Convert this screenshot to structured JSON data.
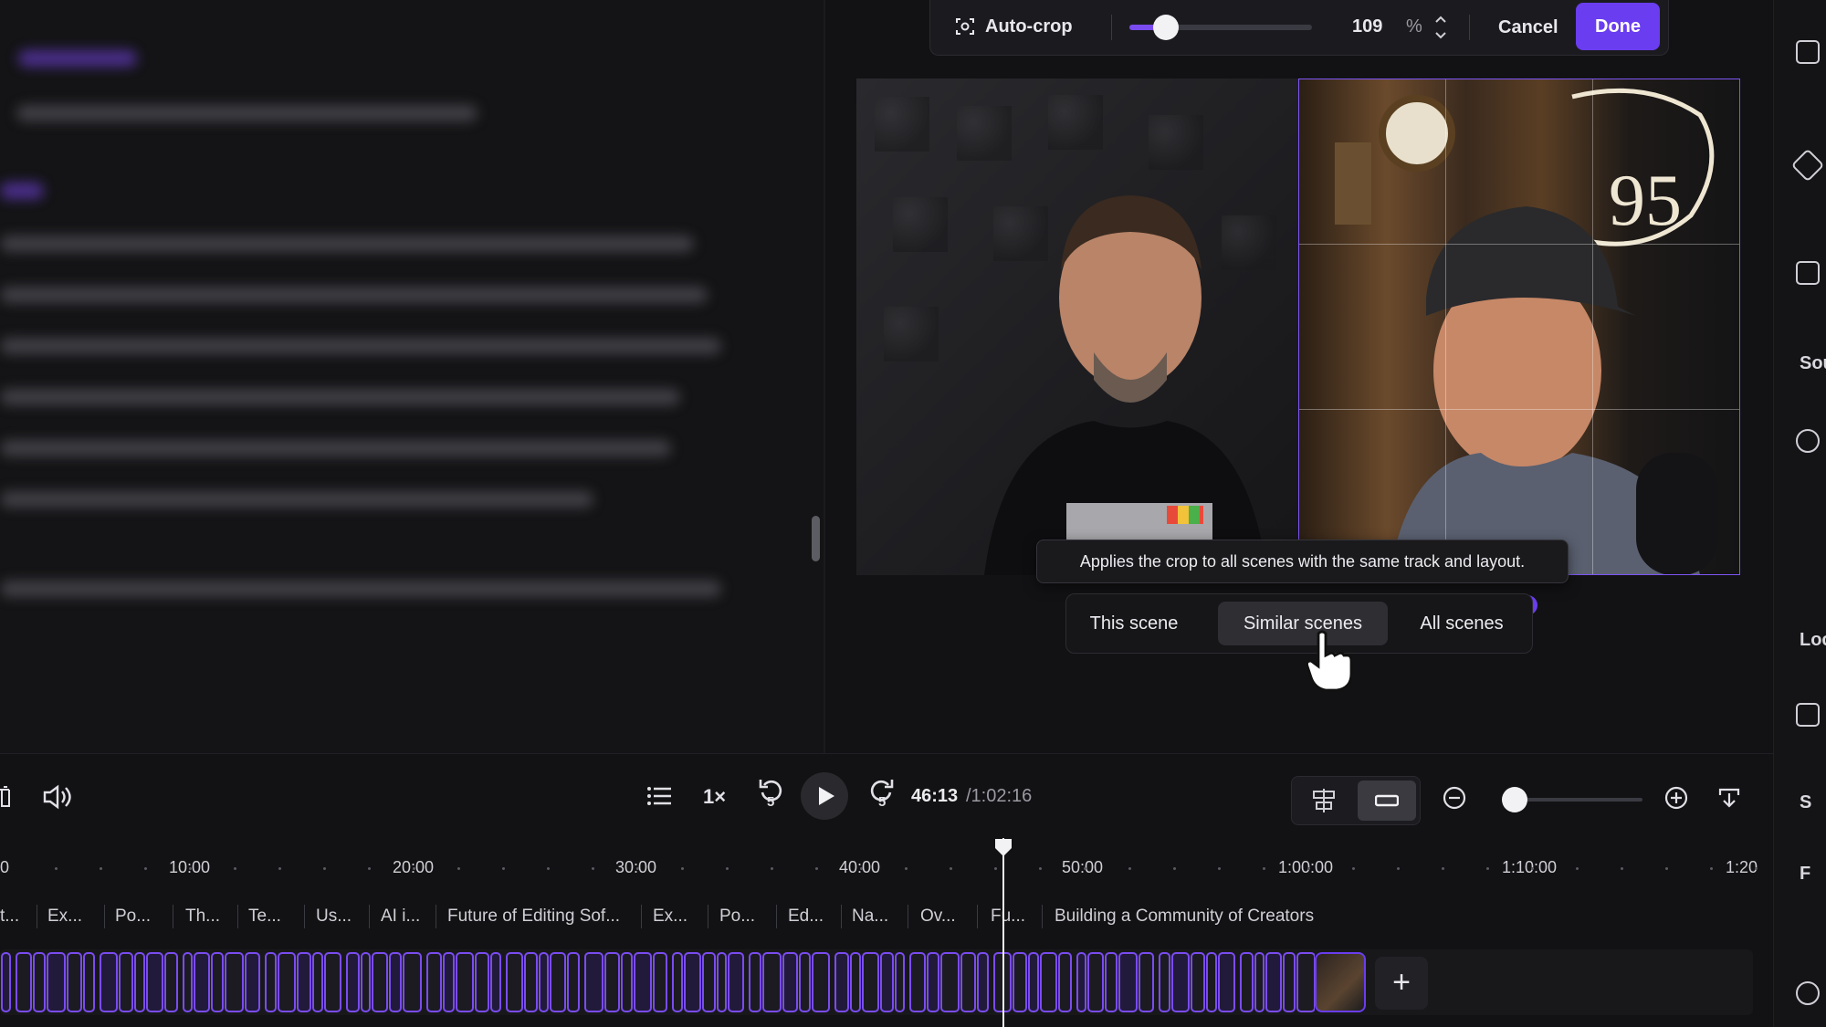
{
  "crop_toolbar": {
    "autocrop_label": "Auto-crop",
    "zoom_value": "109",
    "zoom_unit": "%",
    "zoom_slider_fraction": 0.2,
    "cancel_label": "Cancel",
    "done_label": "Done"
  },
  "tooltip": {
    "text": "Applies the crop to all scenes with the same track and layout."
  },
  "scene_options": {
    "items": [
      {
        "label": "This scene"
      },
      {
        "label": "Similar scenes"
      },
      {
        "label": "All scenes"
      }
    ],
    "selected": "Similar scenes"
  },
  "player": {
    "speed_label": "1×",
    "skip_back_label": "5",
    "skip_fwd_label": "5",
    "current_time": "46:13",
    "total_time": "/1:02:16"
  },
  "ruler": {
    "ticks": [
      "0",
      "10:00",
      "20:00",
      "30:00",
      "40:00",
      "50:00",
      "1:00:00",
      "1:10:00",
      "1:20"
    ]
  },
  "chapters": {
    "items": [
      "t...",
      "Ex...",
      "Po...",
      "Th...",
      "Te...",
      "Us...",
      "AI i...",
      "Future of Editing Sof...",
      "Ex...",
      "Po...",
      "Ed...",
      "Na...",
      "Ov...",
      "Fu...",
      "Building a Community of Creators"
    ]
  },
  "right_panel": {
    "labels": [
      "Sou",
      "Loc",
      "S",
      "F"
    ]
  },
  "colors": {
    "accent": "#6a3df0",
    "background": "#121214",
    "text": "#ececf0"
  },
  "icons": [
    "focus-scan-icon",
    "chevron-up-icon",
    "chevron-down-icon",
    "volume-icon",
    "list-icon",
    "rewind-5-icon",
    "play-icon",
    "forward-5-icon",
    "align-icon",
    "minus-bar-icon",
    "zoom-out-icon",
    "zoom-in-icon",
    "download-icon",
    "plus-icon",
    "hand-cursor-icon"
  ]
}
